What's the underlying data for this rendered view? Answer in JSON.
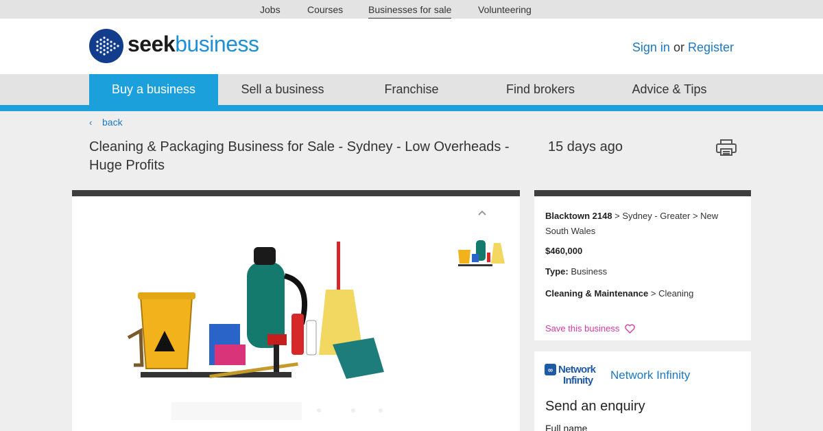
{
  "topnav": {
    "items": [
      "Jobs",
      "Courses",
      "Businesses for sale",
      "Volunteering"
    ],
    "active": "Businesses for sale"
  },
  "header": {
    "logo_seek": "seek",
    "logo_business": "business",
    "sign_in": "Sign in",
    "or": "or",
    "register": "Register"
  },
  "mainnav": {
    "items": [
      "Buy a business",
      "Sell a business",
      "Franchise",
      "Find brokers",
      "Advice & Tips"
    ],
    "active": "Buy a business"
  },
  "listing": {
    "back_label": "back",
    "back_icon": "chevron-left-icon",
    "title": "Cleaning & Packaging Business for Sale - Sydney - Low Overheads - Huge Profits",
    "posted": "15 days ago",
    "print_icon": "printer-icon"
  },
  "details": {
    "suburb": "Blacktown 2148",
    "region_path": " > Sydney - Greater > New South Wales",
    "price": "$460,000",
    "type_label": "Type:",
    "type_value": " Business",
    "category": "Cleaning & Maintenance",
    "subcategory": " > Cleaning",
    "save_label": "Save this business",
    "save_icon": "heart-icon"
  },
  "broker": {
    "logo_line1": "Network",
    "logo_line2": "Infinity",
    "name": "Network Infinity"
  },
  "enquiry": {
    "heading": "Send an enquiry",
    "full_name_label": "Full name"
  },
  "colors": {
    "accent": "#1ba0dc",
    "link": "#1d78c0",
    "save": "#d93aa1",
    "logo_navy": "#123d8c"
  }
}
